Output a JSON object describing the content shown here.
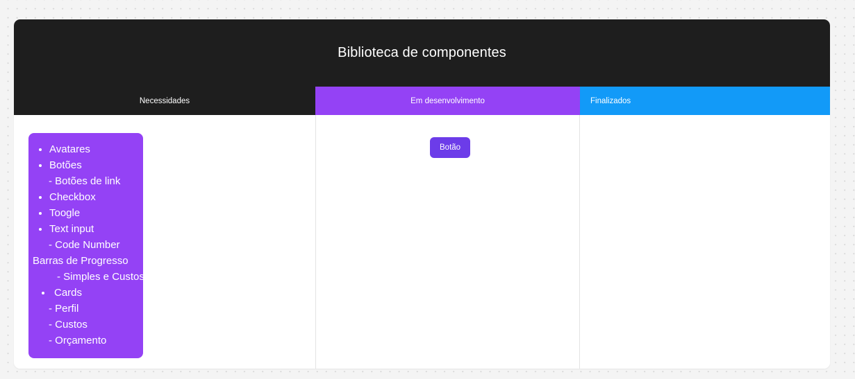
{
  "board": {
    "title": "Biblioteca de componentes",
    "header_bg": "#1e1e1e",
    "columns": [
      {
        "label": "Necessidades",
        "color": "#1e1e1e",
        "align": "center"
      },
      {
        "label": "Em desenvolvimento",
        "color": "#9442f5",
        "align": "center"
      },
      {
        "label": "Finalizados",
        "color": "#129af8",
        "align": "left"
      }
    ]
  },
  "needs_card": {
    "bg": "#9442f5",
    "items": [
      {
        "text": "Avatares",
        "style": "lvl-bullet"
      },
      {
        "text": "Botões",
        "style": "lvl-bullet"
      },
      {
        "text": "- Botões de link",
        "style": "lvl-dash"
      },
      {
        "text": "Checkbox",
        "style": "lvl-bullet"
      },
      {
        "text": "Toogle",
        "style": "lvl-bullet"
      },
      {
        "text": "Text input",
        "style": "lvl-bullet"
      },
      {
        "text": "- Code Number",
        "style": "lvl-dash"
      },
      {
        "text": "Barras de Progresso",
        "style": "lvl-plain"
      },
      {
        "text": "- Simples e Custos",
        "style": "lvl-dash-deep"
      },
      {
        "text": "Cards",
        "style": "lvl-bullet-wide"
      },
      {
        "text": "- Perfil",
        "style": "lvl-dash"
      },
      {
        "text": "- Custos",
        "style": "lvl-dash"
      },
      {
        "text": "- Orçamento",
        "style": "lvl-dash"
      }
    ]
  },
  "in_progress": {
    "button_label": "Botão",
    "button_color": "#6c3ce9"
  },
  "finished": {
    "items": []
  }
}
